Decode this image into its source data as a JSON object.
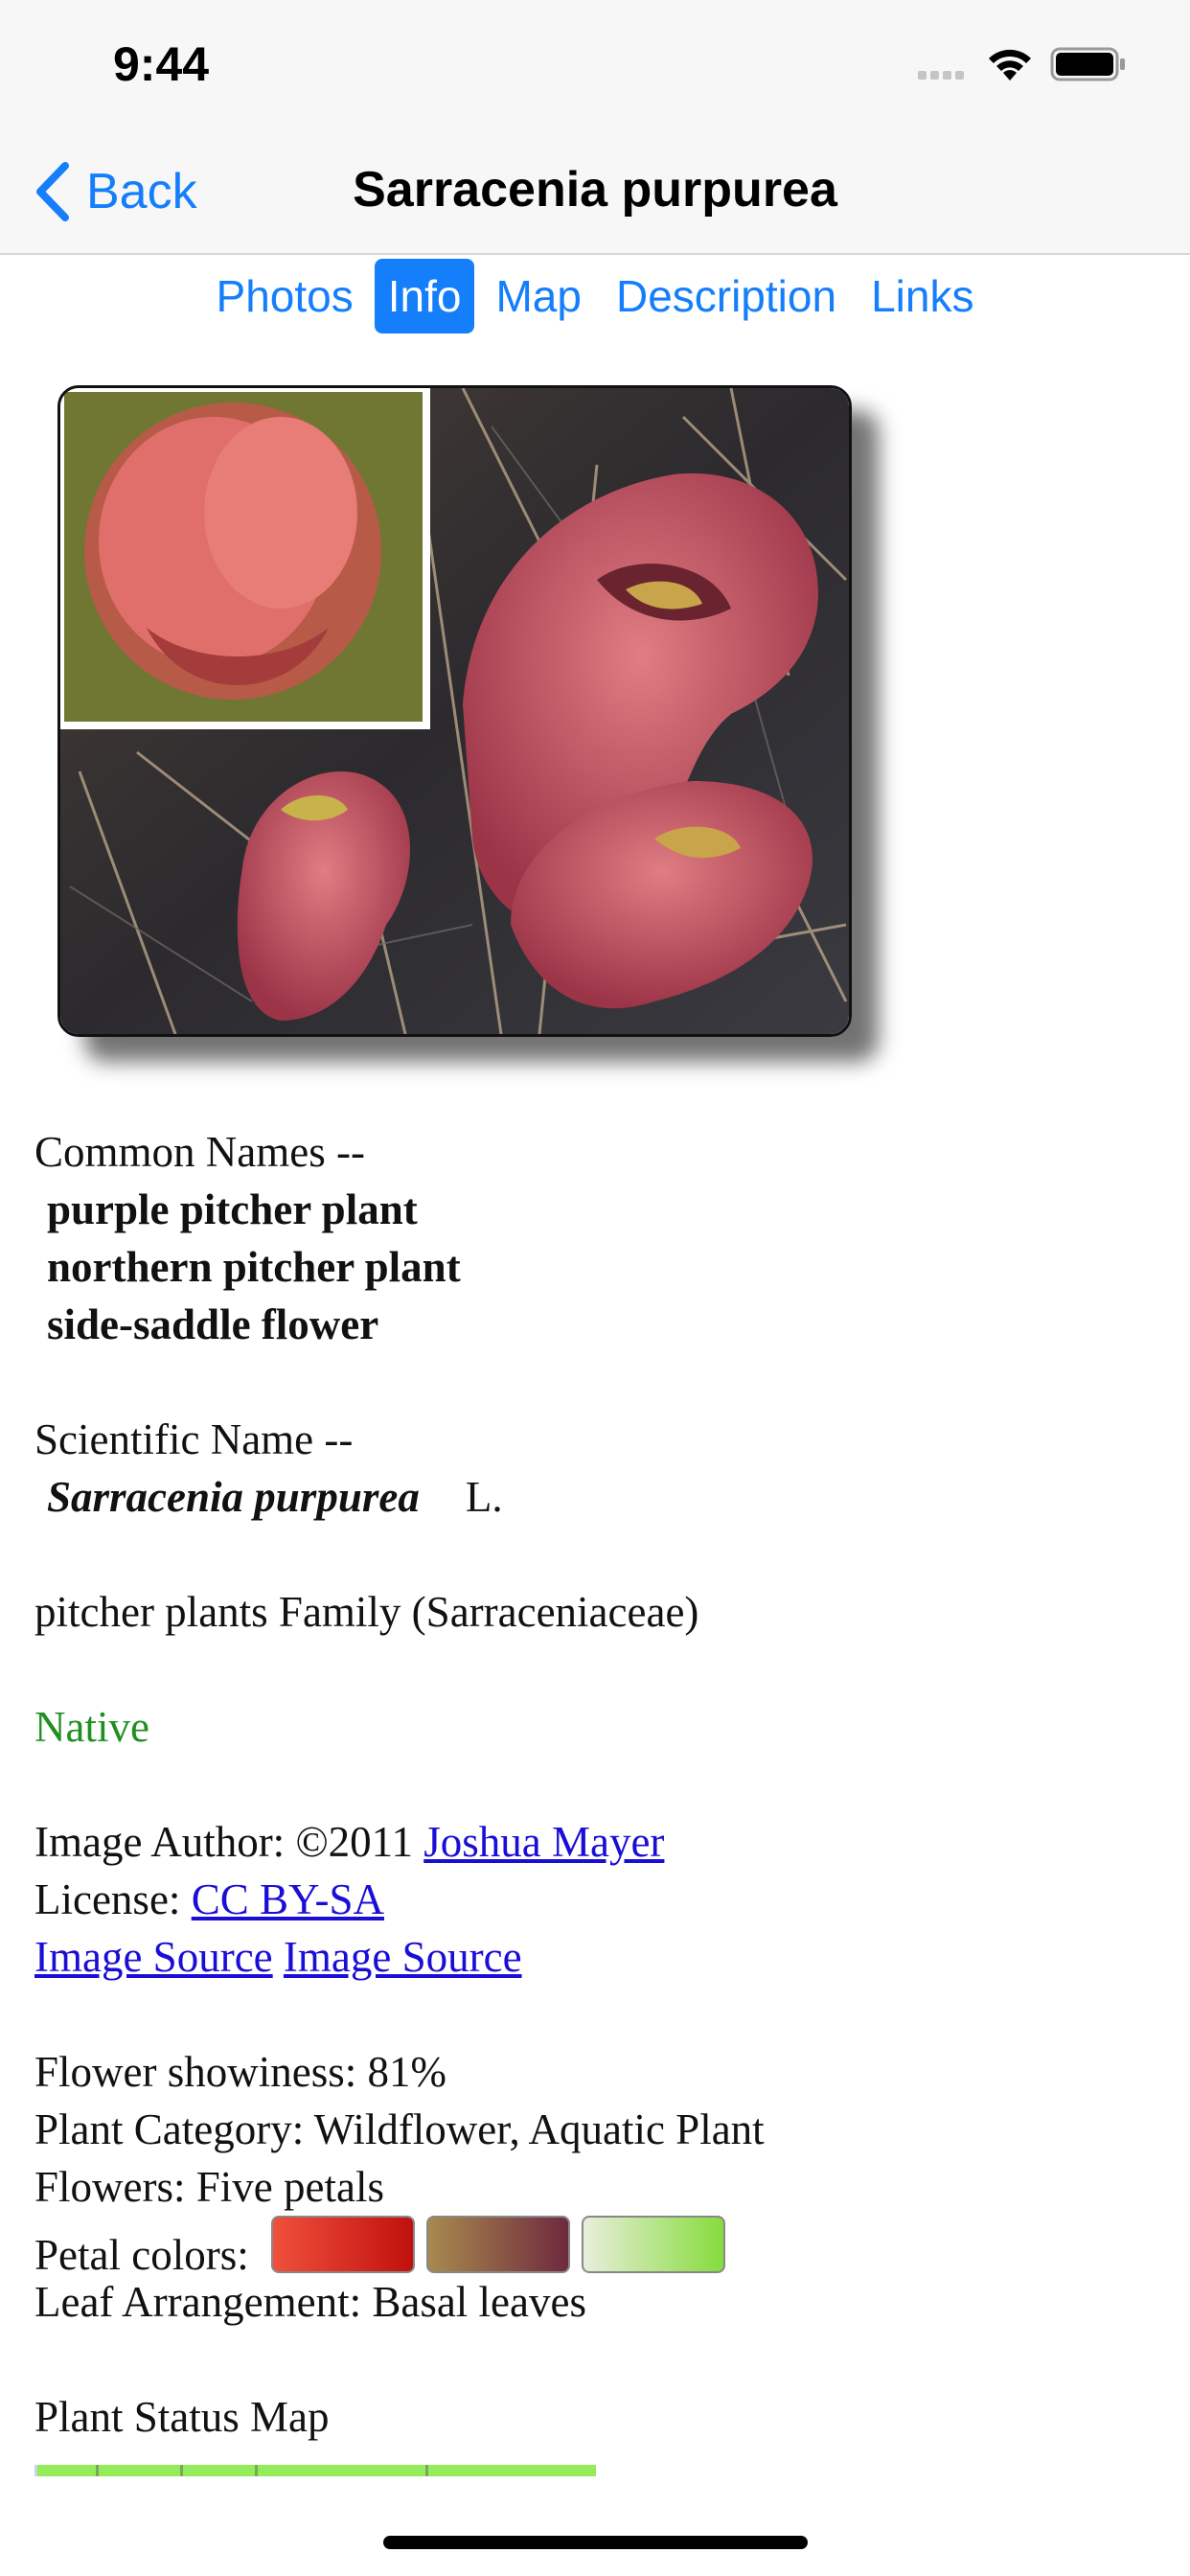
{
  "status_bar": {
    "time": "9:44"
  },
  "nav": {
    "back_label": "Back",
    "title": "Sarracenia purpurea"
  },
  "tabs": [
    {
      "label": "Photos",
      "active": false
    },
    {
      "label": "Info",
      "active": true
    },
    {
      "label": "Map",
      "active": false
    },
    {
      "label": "Description",
      "active": false
    },
    {
      "label": "Links",
      "active": false
    }
  ],
  "common_names": {
    "label": "Common Names --",
    "names": [
      "purple pitcher plant",
      "northern pitcher plant",
      "side-saddle flower"
    ]
  },
  "scientific_name": {
    "label": "Scientific Name --",
    "name": "Sarracenia purpurea",
    "author": "L."
  },
  "family": "pitcher plants Family (Sarraceniaceae)",
  "status": "Native",
  "credits": {
    "author_prefix": "Image Author: ©2011",
    "author_link": "Joshua Mayer",
    "license_prefix": "License:",
    "license_link": "CC BY-SA",
    "source_links": [
      "Image Source",
      "Image Source"
    ]
  },
  "attributes": {
    "showiness": "Flower showiness: 81%",
    "category": "Plant Category: Wildflower, Aquatic Plant",
    "flowers": "Flowers: Five petals",
    "petal_colors_label": "Petal colors:",
    "petal_colors": [
      {
        "from": "#f0503c",
        "to": "#c0100c"
      },
      {
        "from": "#a88a4e",
        "to": "#6e2a3e"
      },
      {
        "from": "#e9eedc",
        "to": "#86dc3c"
      }
    ],
    "leaf_arrangement": "Leaf Arrangement: Basal leaves"
  },
  "status_map_label": "Plant Status Map",
  "colors": {
    "accent": "#147efb",
    "link": "#1a0dd6",
    "native": "#1f8f1f"
  }
}
